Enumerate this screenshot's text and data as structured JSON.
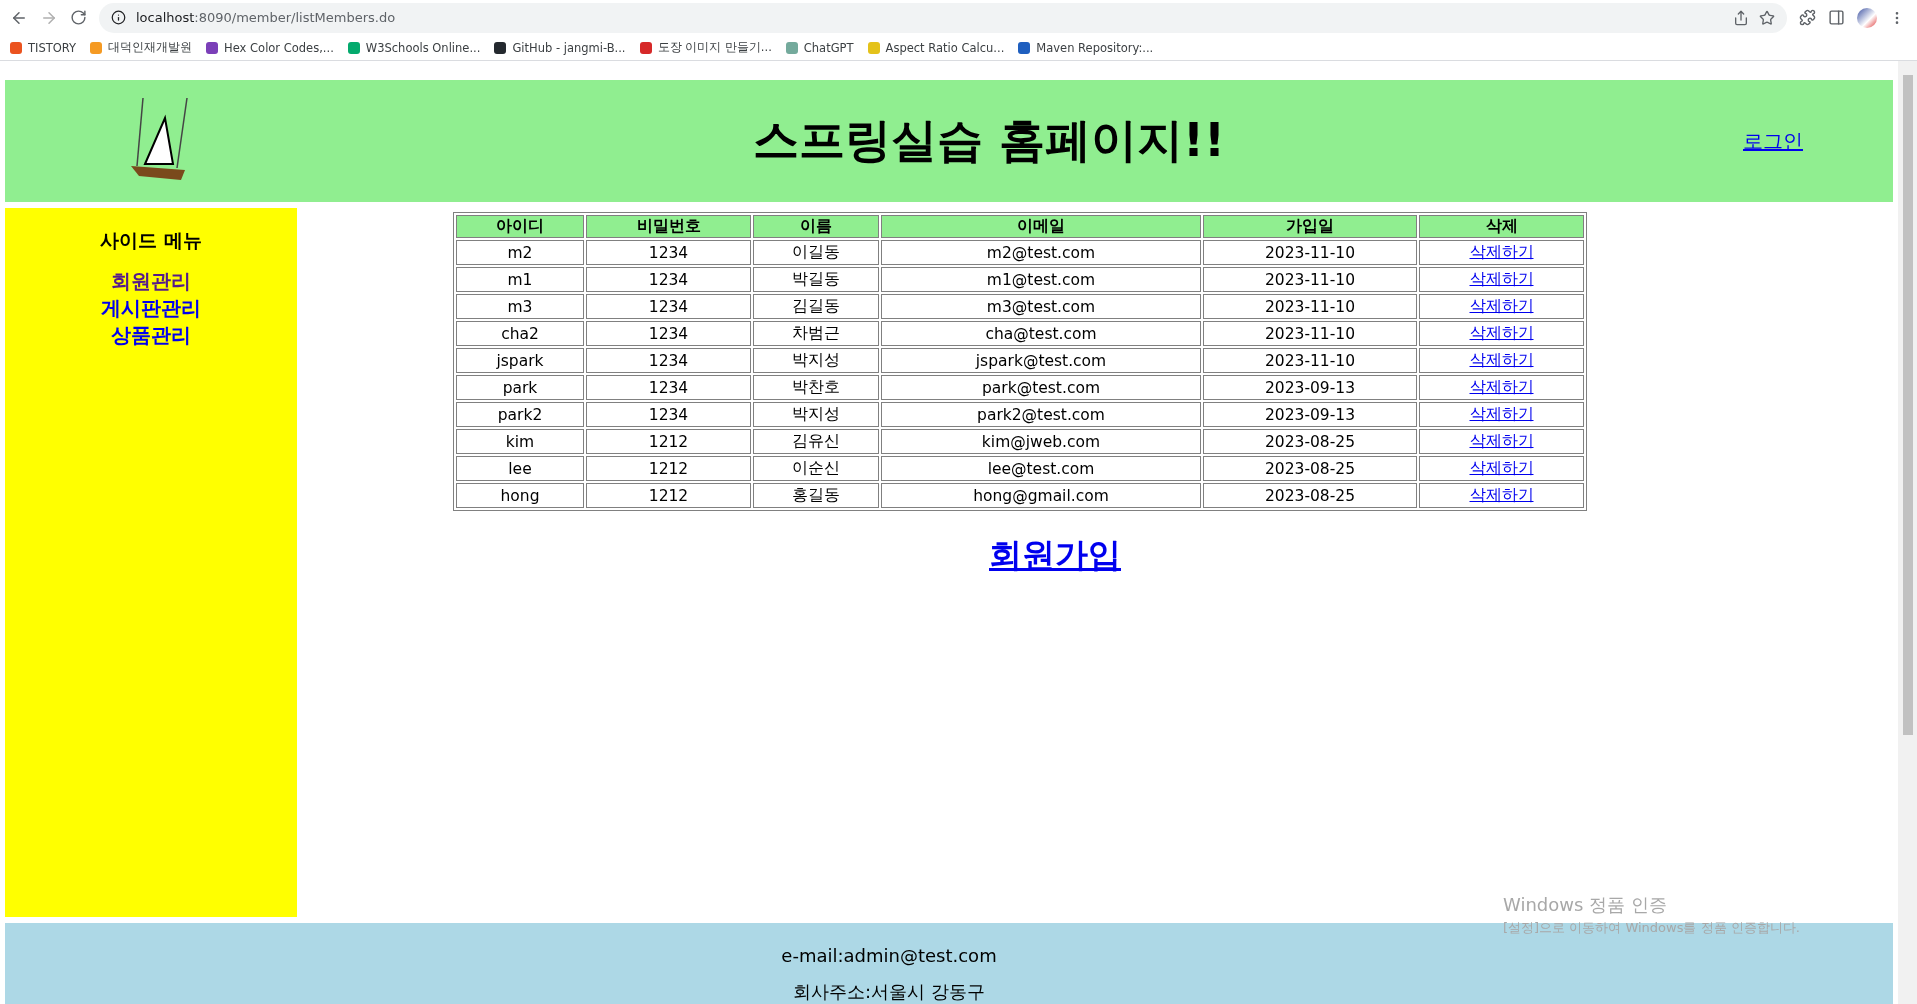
{
  "browser": {
    "url_host": "localhost",
    "url_rest": ":8090/member/listMembers.do",
    "bookmarks": [
      {
        "label": "TISTORY",
        "color": "#eb531f"
      },
      {
        "label": "대덕인재개발원",
        "color": "#f59a23"
      },
      {
        "label": "Hex Color Codes,...",
        "color": "#7b3fb8"
      },
      {
        "label": "W3Schools Online...",
        "color": "#04aa6d"
      },
      {
        "label": "GitHub - jangmi-B...",
        "color": "#24292f"
      },
      {
        "label": "도장 이미지 만들기...",
        "color": "#d62828"
      },
      {
        "label": "ChatGPT",
        "color": "#74aa9c"
      },
      {
        "label": "Aspect Ratio Calcu...",
        "color": "#e4c21a"
      },
      {
        "label": "Maven Repository:...",
        "color": "#1f5fbf"
      }
    ]
  },
  "header": {
    "title": "스프링실습 홈페이지!!",
    "login": "로그인"
  },
  "sidebar": {
    "title": "사이드 메뉴",
    "items": [
      {
        "label": "회원관리",
        "visited": true
      },
      {
        "label": "게시판관리",
        "visited": false
      },
      {
        "label": "상품관리",
        "visited": false
      }
    ]
  },
  "table": {
    "columns": [
      "아이디",
      "비밀번호",
      "이름",
      "이메일",
      "가입일",
      "삭제"
    ],
    "rows": [
      {
        "id": "m2",
        "password": "1234",
        "name": "이길동",
        "email": "m2@test.com",
        "joined": "2023-11-10",
        "action": "삭제하기"
      },
      {
        "id": "m1",
        "password": "1234",
        "name": "박길동",
        "email": "m1@test.com",
        "joined": "2023-11-10",
        "action": "삭제하기"
      },
      {
        "id": "m3",
        "password": "1234",
        "name": "김길동",
        "email": "m3@test.com",
        "joined": "2023-11-10",
        "action": "삭제하기"
      },
      {
        "id": "cha2",
        "password": "1234",
        "name": "차범근",
        "email": "cha@test.com",
        "joined": "2023-11-10",
        "action": "삭제하기"
      },
      {
        "id": "jspark",
        "password": "1234",
        "name": "박지성",
        "email": "jspark@test.com",
        "joined": "2023-11-10",
        "action": "삭제하기"
      },
      {
        "id": "park",
        "password": "1234",
        "name": "박찬호",
        "email": "park@test.com",
        "joined": "2023-09-13",
        "action": "삭제하기"
      },
      {
        "id": "park2",
        "password": "1234",
        "name": "박지성",
        "email": "park2@test.com",
        "joined": "2023-09-13",
        "action": "삭제하기"
      },
      {
        "id": "kim",
        "password": "1212",
        "name": "김유신",
        "email": "kim@jweb.com",
        "joined": "2023-08-25",
        "action": "삭제하기"
      },
      {
        "id": "lee",
        "password": "1212",
        "name": "이순신",
        "email": "lee@test.com",
        "joined": "2023-08-25",
        "action": "삭제하기"
      },
      {
        "id": "hong",
        "password": "1212",
        "name": "홍길동",
        "email": "hong@gmail.com",
        "joined": "2023-08-25",
        "action": "삭제하기"
      }
    ]
  },
  "join_link": "회원가입",
  "footer": {
    "email": "e-mail:admin@test.com",
    "address": "회사주소:서울시 강동구"
  },
  "os_notice": {
    "title": "Windows 정품 인증",
    "text": "[설정]으로 이동하여 Windows를 정품 인증합니다."
  }
}
